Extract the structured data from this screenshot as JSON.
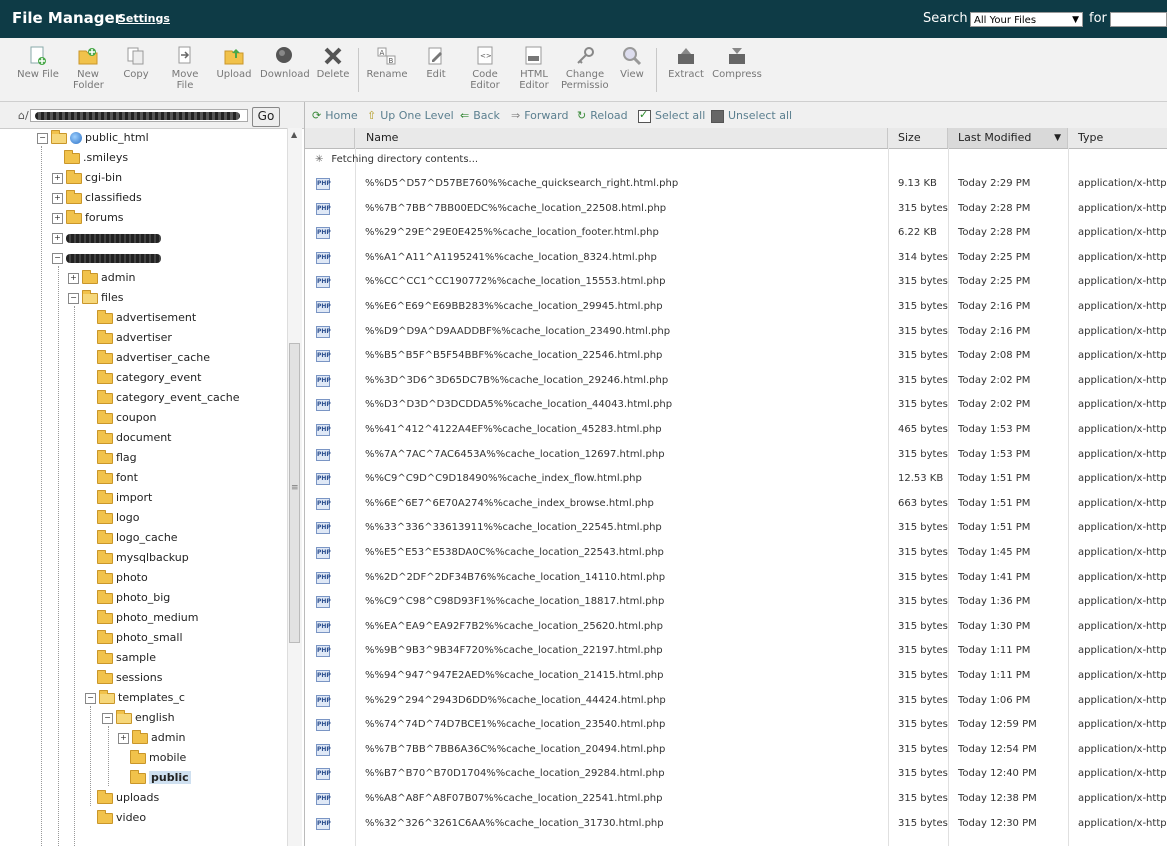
{
  "header": {
    "title": "File Manager",
    "settings_link": "Settings",
    "search_label": "Search",
    "search_scope": "All Your Files",
    "for_label": "for"
  },
  "toolbar": {
    "items": [
      {
        "label": "New File",
        "icon": "new-file-icon"
      },
      {
        "label": "New Folder",
        "icon": "new-folder-icon"
      },
      {
        "label": "Copy",
        "icon": "copy-icon"
      },
      {
        "label": "Move File",
        "icon": "move-file-icon"
      },
      {
        "label": "Upload",
        "icon": "upload-icon"
      },
      {
        "label": "Download",
        "icon": "download-icon"
      },
      {
        "label": "Delete",
        "icon": "delete-icon"
      },
      {
        "label": "Rename",
        "icon": "rename-icon"
      },
      {
        "label": "Edit",
        "icon": "edit-icon"
      },
      {
        "label": "Code Editor",
        "icon": "code-editor-icon"
      },
      {
        "label": "HTML Editor",
        "icon": "html-editor-icon"
      },
      {
        "label": "Change Permissions",
        "icon": "change-permissions-icon"
      },
      {
        "label": "View",
        "icon": "view-icon"
      },
      {
        "label": "Extract",
        "icon": "extract-icon"
      },
      {
        "label": "Compress",
        "icon": "compress-icon"
      }
    ]
  },
  "pathbar": {
    "go_label": "Go"
  },
  "tree": [
    {
      "label": "public_html"
    },
    {
      "label": ".smileys"
    },
    {
      "label": "cgi-bin"
    },
    {
      "label": "classifieds"
    },
    {
      "label": "forums"
    },
    {
      "label": "admin"
    },
    {
      "label": "files"
    },
    {
      "label": "advertisement"
    },
    {
      "label": "advertiser"
    },
    {
      "label": "advertiser_cache"
    },
    {
      "label": "category_event"
    },
    {
      "label": "category_event_cache"
    },
    {
      "label": "coupon"
    },
    {
      "label": "document"
    },
    {
      "label": "flag"
    },
    {
      "label": "font"
    },
    {
      "label": "import"
    },
    {
      "label": "logo"
    },
    {
      "label": "logo_cache"
    },
    {
      "label": "mysqlbackup"
    },
    {
      "label": "photo"
    },
    {
      "label": "photo_big"
    },
    {
      "label": "photo_medium"
    },
    {
      "label": "photo_small"
    },
    {
      "label": "sample"
    },
    {
      "label": "sessions"
    },
    {
      "label": "templates_c"
    },
    {
      "label": "english"
    },
    {
      "label": "admin"
    },
    {
      "label": "mobile"
    },
    {
      "label": "public"
    },
    {
      "label": "uploads"
    },
    {
      "label": "video"
    }
  ],
  "nav": {
    "home": "Home",
    "up_one_level": "Up One Level",
    "back": "Back",
    "forward": "Forward",
    "reload": "Reload",
    "select_all": "Select all",
    "unselect_all": "Unselect all"
  },
  "columns": {
    "name": "Name",
    "size": "Size",
    "last_modified": "Last Modified",
    "type": "Type"
  },
  "status": "Fetching directory contents...",
  "files": [
    {
      "name": "%%D5^D57^D57BE760%%cache_quicksearch_right.html.php",
      "size": "9.13 KB",
      "modified": "Today 2:29 PM",
      "type": "application/x-httpd-php"
    },
    {
      "name": "%%7B^7BB^7BB00EDC%%cache_location_22508.html.php",
      "size": "315 bytes",
      "modified": "Today 2:28 PM",
      "type": "application/x-httpd-php"
    },
    {
      "name": "%%29^29E^29E0E425%%cache_location_footer.html.php",
      "size": "6.22 KB",
      "modified": "Today 2:28 PM",
      "type": "application/x-httpd-php"
    },
    {
      "name": "%%A1^A11^A1195241%%cache_location_8324.html.php",
      "size": "314 bytes",
      "modified": "Today 2:25 PM",
      "type": "application/x-httpd-php"
    },
    {
      "name": "%%CC^CC1^CC190772%%cache_location_15553.html.php",
      "size": "315 bytes",
      "modified": "Today 2:25 PM",
      "type": "application/x-httpd-php"
    },
    {
      "name": "%%E6^E69^E69BB283%%cache_location_29945.html.php",
      "size": "315 bytes",
      "modified": "Today 2:16 PM",
      "type": "application/x-httpd-php"
    },
    {
      "name": "%%D9^D9A^D9AADDBF%%cache_location_23490.html.php",
      "size": "315 bytes",
      "modified": "Today 2:16 PM",
      "type": "application/x-httpd-php"
    },
    {
      "name": "%%B5^B5F^B5F54BBF%%cache_location_22546.html.php",
      "size": "315 bytes",
      "modified": "Today 2:08 PM",
      "type": "application/x-httpd-php"
    },
    {
      "name": "%%3D^3D6^3D65DC7B%%cache_location_29246.html.php",
      "size": "315 bytes",
      "modified": "Today 2:02 PM",
      "type": "application/x-httpd-php"
    },
    {
      "name": "%%D3^D3D^D3DCDDA5%%cache_location_44043.html.php",
      "size": "315 bytes",
      "modified": "Today 2:02 PM",
      "type": "application/x-httpd-php"
    },
    {
      "name": "%%41^412^4122A4EF%%cache_location_45283.html.php",
      "size": "465 bytes",
      "modified": "Today 1:53 PM",
      "type": "application/x-httpd-php"
    },
    {
      "name": "%%7A^7AC^7AC6453A%%cache_location_12697.html.php",
      "size": "315 bytes",
      "modified": "Today 1:53 PM",
      "type": "application/x-httpd-php"
    },
    {
      "name": "%%C9^C9D^C9D18490%%cache_index_flow.html.php",
      "size": "12.53 KB",
      "modified": "Today 1:51 PM",
      "type": "application/x-httpd-php"
    },
    {
      "name": "%%6E^6E7^6E70A274%%cache_index_browse.html.php",
      "size": "663 bytes",
      "modified": "Today 1:51 PM",
      "type": "application/x-httpd-php"
    },
    {
      "name": "%%33^336^33613911%%cache_location_22545.html.php",
      "size": "315 bytes",
      "modified": "Today 1:51 PM",
      "type": "application/x-httpd-php"
    },
    {
      "name": "%%E5^E53^E538DA0C%%cache_location_22543.html.php",
      "size": "315 bytes",
      "modified": "Today 1:45 PM",
      "type": "application/x-httpd-php"
    },
    {
      "name": "%%2D^2DF^2DF34B76%%cache_location_14110.html.php",
      "size": "315 bytes",
      "modified": "Today 1:41 PM",
      "type": "application/x-httpd-php"
    },
    {
      "name": "%%C9^C98^C98D93F1%%cache_location_18817.html.php",
      "size": "315 bytes",
      "modified": "Today 1:36 PM",
      "type": "application/x-httpd-php"
    },
    {
      "name": "%%EA^EA9^EA92F7B2%%cache_location_25620.html.php",
      "size": "315 bytes",
      "modified": "Today 1:30 PM",
      "type": "application/x-httpd-php"
    },
    {
      "name": "%%9B^9B3^9B34F720%%cache_location_22197.html.php",
      "size": "315 bytes",
      "modified": "Today 1:11 PM",
      "type": "application/x-httpd-php"
    },
    {
      "name": "%%94^947^947E2AED%%cache_location_21415.html.php",
      "size": "315 bytes",
      "modified": "Today 1:11 PM",
      "type": "application/x-httpd-php"
    },
    {
      "name": "%%29^294^2943D6DD%%cache_location_44424.html.php",
      "size": "315 bytes",
      "modified": "Today 1:06 PM",
      "type": "application/x-httpd-php"
    },
    {
      "name": "%%74^74D^74D7BCE1%%cache_location_23540.html.php",
      "size": "315 bytes",
      "modified": "Today 12:59 PM",
      "type": "application/x-httpd-php"
    },
    {
      "name": "%%7B^7BB^7BB6A36C%%cache_location_20494.html.php",
      "size": "315 bytes",
      "modified": "Today 12:54 PM",
      "type": "application/x-httpd-php"
    },
    {
      "name": "%%B7^B70^B70D1704%%cache_location_29284.html.php",
      "size": "315 bytes",
      "modified": "Today 12:40 PM",
      "type": "application/x-httpd-php"
    },
    {
      "name": "%%A8^A8F^A8F07B07%%cache_location_22541.html.php",
      "size": "315 bytes",
      "modified": "Today 12:38 PM",
      "type": "application/x-httpd-php"
    },
    {
      "name": "%%32^326^3261C6AA%%cache_location_31730.html.php",
      "size": "315 bytes",
      "modified": "Today 12:30 PM",
      "type": "application/x-httpd-php"
    }
  ],
  "colors": {
    "header_bg": "#0e3b46",
    "nav_text": "#5b7f8f",
    "folder": "#f1c24b"
  }
}
